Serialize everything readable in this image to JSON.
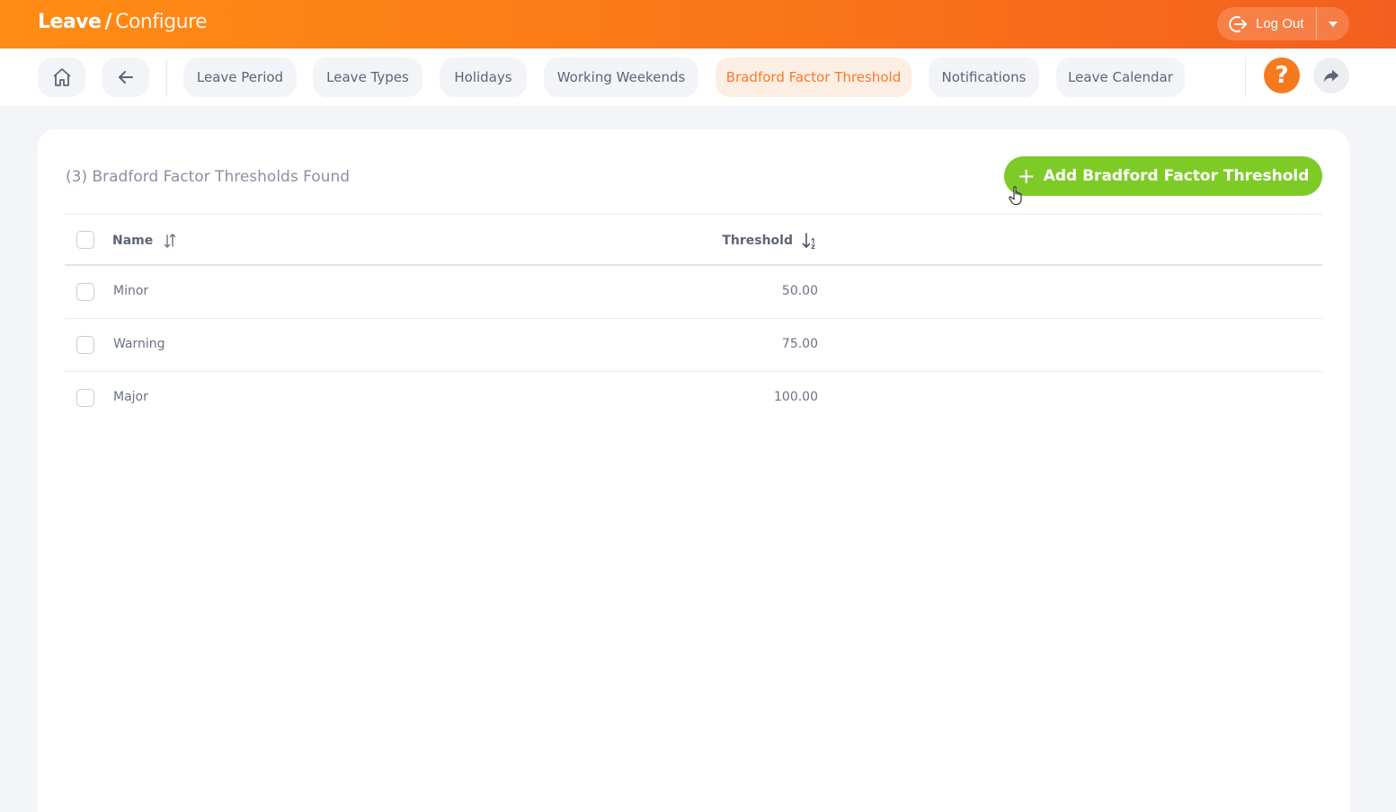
{
  "header": {
    "title": "Leave",
    "separator": "/",
    "subtitle": "Configure",
    "logout_label": "Log Out"
  },
  "nav": {
    "home_icon": "home-icon",
    "back_icon": "arrow-left-icon",
    "tabs": [
      {
        "label": "Leave Period"
      },
      {
        "label": "Leave Types"
      },
      {
        "label": "Holidays"
      },
      {
        "label": "Working Weekends"
      },
      {
        "label": "Bradford Factor Threshold",
        "active": true
      },
      {
        "label": "Notifications"
      },
      {
        "label": "Leave Calendar"
      }
    ],
    "help_label": "?",
    "share_icon": "share-icon"
  },
  "main": {
    "result_count": "(3) Bradford Factor Thresholds Found",
    "add_button": "Add Bradford Factor Threshold",
    "add_icon": "+",
    "columns": {
      "name": "Name",
      "threshold": "Threshold"
    },
    "rows": [
      {
        "name": "Minor",
        "threshold": "50.00"
      },
      {
        "name": "Warning",
        "threshold": "75.00"
      },
      {
        "name": "Major",
        "threshold": "100.00"
      }
    ]
  },
  "colors": {
    "brand_orange": "#f7791e",
    "accent_green": "#7ecb27",
    "active_tab_bg": "#fdeee3"
  }
}
